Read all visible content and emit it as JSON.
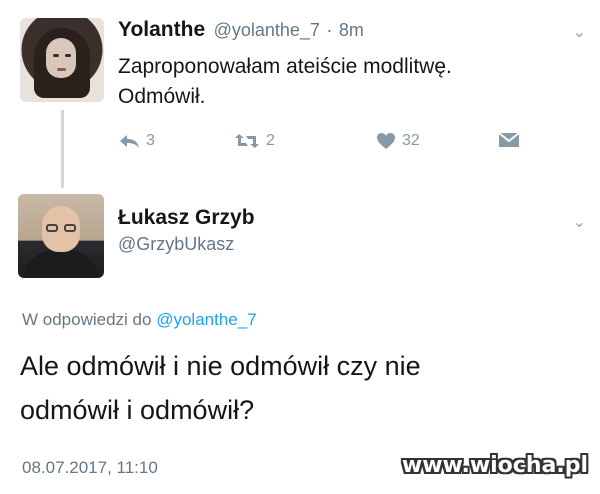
{
  "tweet": {
    "author_name": "Yolanthe",
    "author_handle": "@yolanthe_7",
    "separator": "·",
    "time_ago": "8m",
    "text_line1": "Zaproponowałam ateiście modlitwę.",
    "text_line2": "Odmówił.",
    "reply_count": "3",
    "retweet_count": "2",
    "like_count": "32"
  },
  "reply": {
    "author_name": "Łukasz Grzyb",
    "author_handle": "@GrzybUkasz",
    "replying_prefix": "W odpowiedzi do",
    "replying_to": "@yolanthe_7",
    "text_line1": "Ale odmówił i nie odmówił czy nie",
    "text_line2": "odmówił i odmówił?",
    "timestamp": "08.07.2017, 11:10"
  },
  "watermark": "www.wiocha.pl",
  "colors": {
    "text": "#14171a",
    "secondary": "#657786",
    "icon": "#8899a6",
    "link": "#1da1f2",
    "thread_line": "#cfd8de"
  },
  "icons": [
    "reply-icon",
    "retweet-icon",
    "like-icon",
    "dm-icon",
    "chevron-down-icon"
  ]
}
